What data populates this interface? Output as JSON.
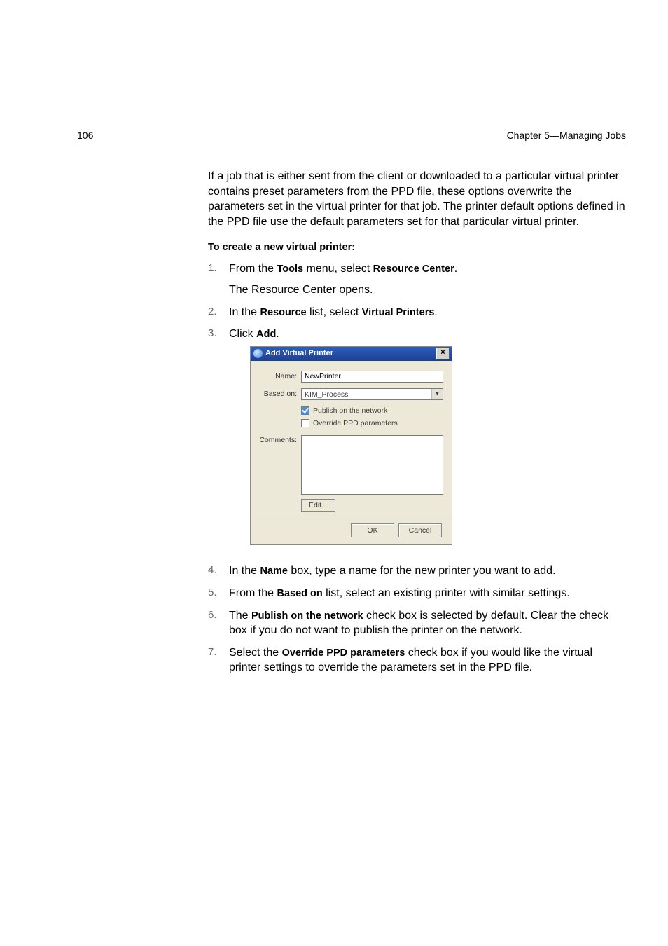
{
  "header": {
    "page_number": "106",
    "chapter": "Chapter 5—Managing Jobs"
  },
  "intro_para": "If a job that is either sent from the client or downloaded to a particular virtual printer contains preset parameters from the PPD file, these options overwrite the parameters set in the virtual printer for that job. The printer default options defined in the PPD file use the default parameters set for that particular virtual printer.",
  "subhead": "To create a new virtual printer:",
  "steps": {
    "s1": {
      "num": "1.",
      "pre": "From the ",
      "b1": "Tools",
      "mid": " menu, select ",
      "b2": "Resource Center",
      "post": ".",
      "sub": "The Resource Center opens."
    },
    "s2": {
      "num": "2.",
      "pre": "In the ",
      "b1": "Resource",
      "mid": " list, select ",
      "b2": "Virtual Printers",
      "post": "."
    },
    "s3": {
      "num": "3.",
      "pre": "Click ",
      "b1": "Add",
      "post": "."
    },
    "s4": {
      "num": "4.",
      "pre": "In the ",
      "b1": "Name",
      "post": " box, type a name for the new printer you want to add."
    },
    "s5": {
      "num": "5.",
      "pre": "From the ",
      "b1": "Based on",
      "post": " list, select an existing printer with similar settings."
    },
    "s6": {
      "num": "6.",
      "pre": "The ",
      "b1": "Publish on the network",
      "post": " check box is selected by default. Clear the check box if you do not want to publish the printer on the network."
    },
    "s7": {
      "num": "7.",
      "pre": "Select the ",
      "b1": "Override PPD parameters",
      "post": " check box if you would like the virtual printer settings to override the parameters set in the PPD file."
    }
  },
  "dialog": {
    "title": "Add Virtual Printer",
    "labels": {
      "name": "Name:",
      "based_on": "Based on:",
      "comments": "Comments:"
    },
    "fields": {
      "name_value": "NewPrinter",
      "based_on_value": "KIM_Process",
      "publish_label": "Publish on the network",
      "publish_checked": true,
      "override_label": "Override PPD parameters",
      "override_checked": false
    },
    "buttons": {
      "edit": "Edit...",
      "ok": "OK",
      "cancel": "Cancel"
    }
  }
}
